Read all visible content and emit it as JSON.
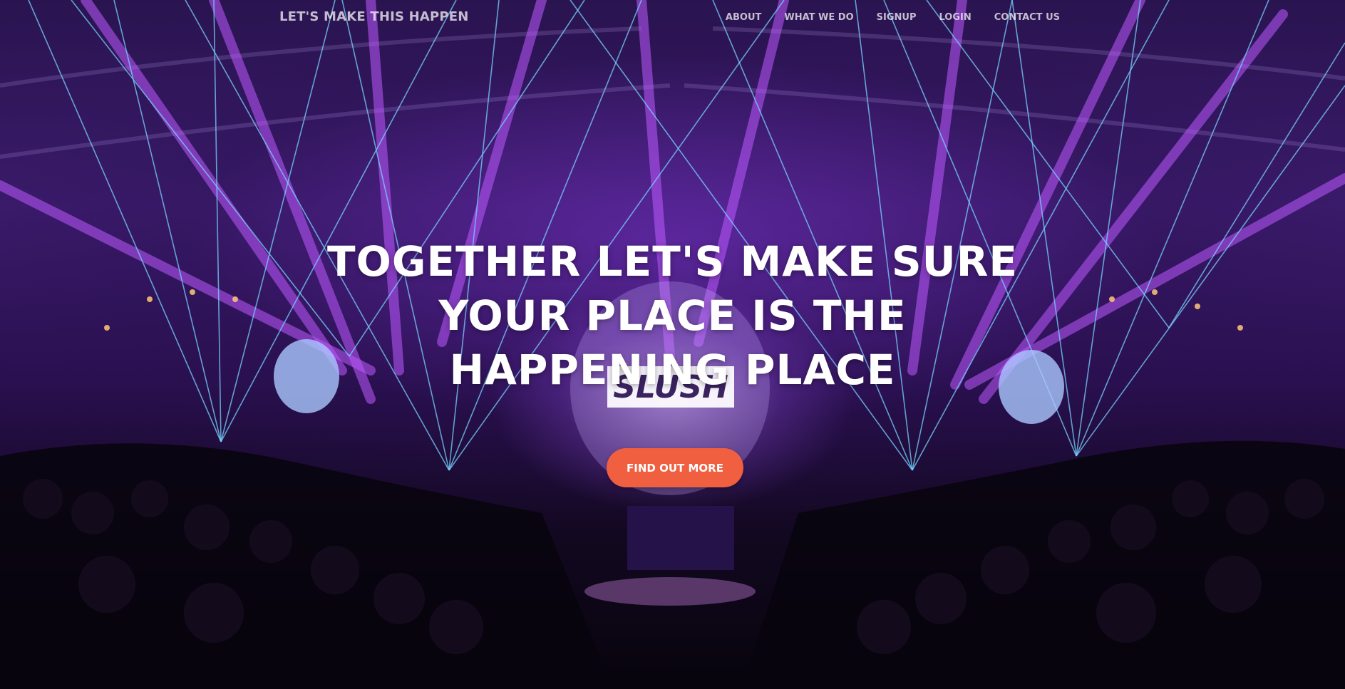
{
  "navbar": {
    "brand": "LET'S MAKE THIS HAPPEN",
    "links": [
      {
        "label": "ABOUT"
      },
      {
        "label": "WHAT WE DO"
      },
      {
        "label": "SIGNUP"
      },
      {
        "label": "LOGIN"
      },
      {
        "label": "CONTACT US"
      }
    ]
  },
  "hero": {
    "headline": "TOGETHER LET'S MAKE SURE YOUR PLACE IS THE HAPPENING PLACE",
    "cta_label": "FIND OUT MORE",
    "background_image": "concert-stage-with-lasers-photo",
    "stage_logo": "SLUSH"
  },
  "colors": {
    "accent": "#f05f40",
    "laser_blue": "#4fc3ff",
    "laser_purple": "#b04dff",
    "heading_text": "#ffffff"
  }
}
